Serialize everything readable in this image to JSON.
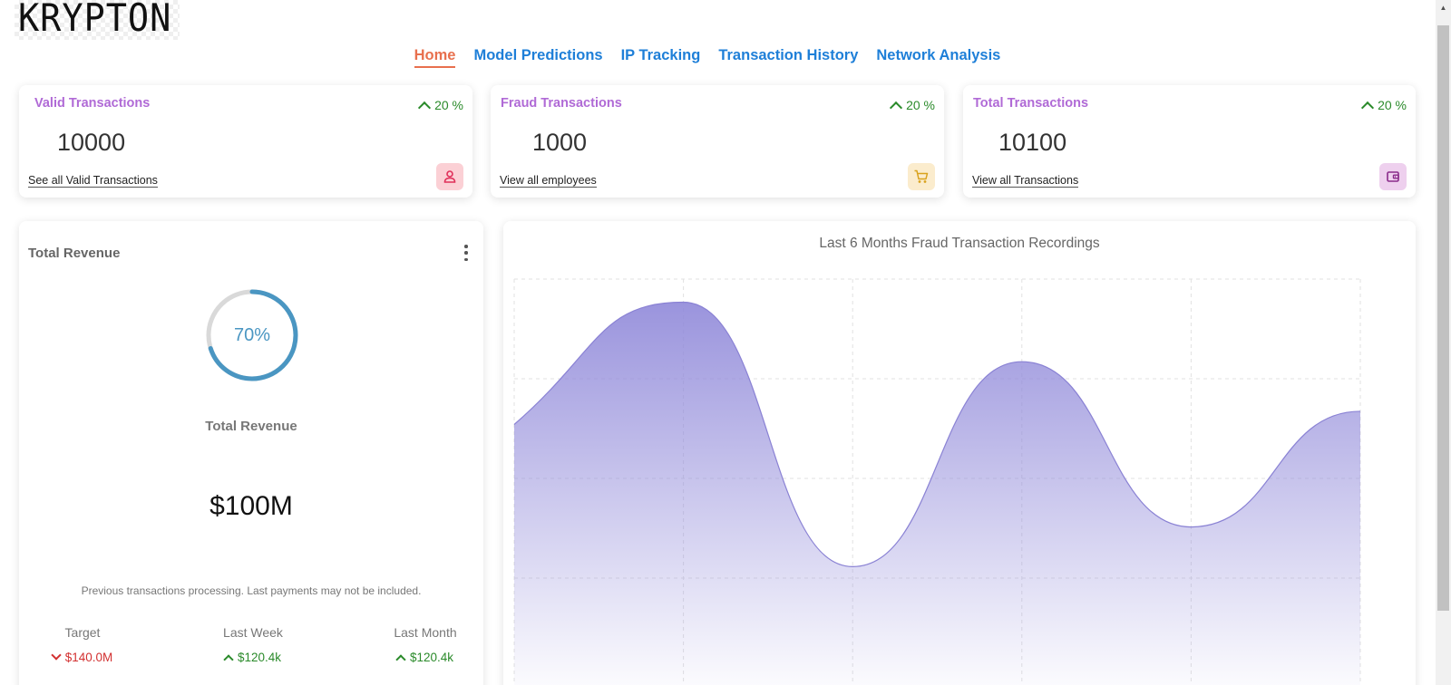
{
  "logo": {
    "text": "KRYPTON"
  },
  "nav": {
    "items": [
      {
        "label": "Home",
        "active": true
      },
      {
        "label": "Model Predictions",
        "active": false
      },
      {
        "label": "IP Tracking",
        "active": false
      },
      {
        "label": "Transaction History",
        "active": false
      },
      {
        "label": "Network Analysis",
        "active": false
      }
    ]
  },
  "stats": [
    {
      "title": "Valid Transactions",
      "change": "20 %",
      "value": "10000",
      "link": "See all Valid Transactions",
      "icon": "person-icon",
      "icon_color": "#e0305a",
      "icon_bg": "#fbd0d5"
    },
    {
      "title": "Fraud Transactions",
      "change": "20 %",
      "value": "1000",
      "link": "View all employees",
      "icon": "cart-icon",
      "icon_color": "#d9a21d",
      "icon_bg": "#fbeccd"
    },
    {
      "title": "Total Transactions",
      "change": "20 %",
      "value": "10100",
      "link": "View all Transactions",
      "icon": "wallet-icon",
      "icon_color": "#8a2a8a",
      "icon_bg": "#eed0ee"
    }
  ],
  "revenue": {
    "title": "Total Revenue",
    "percent": "70%",
    "percent_value": 0.7,
    "subtitle": "Total Revenue",
    "amount": "$100M",
    "note": "Previous transactions processing. Last payments may not be included.",
    "metrics": [
      {
        "label": "Target",
        "value": "$140.0M",
        "trend": "down"
      },
      {
        "label": "Last Week",
        "value": "$120.4k",
        "trend": "up"
      },
      {
        "label": "Last Month",
        "value": "$120.4k",
        "trend": "up"
      }
    ]
  },
  "chart_data": {
    "type": "area",
    "title": "Last 6 Months Fraud Transaction Recordings",
    "x": [
      0,
      1,
      2,
      3,
      4,
      5
    ],
    "values": [
      61,
      98,
      18,
      80,
      30,
      65
    ],
    "ylim": [
      -20,
      105
    ],
    "grid": true,
    "color": "#8f88d9"
  }
}
